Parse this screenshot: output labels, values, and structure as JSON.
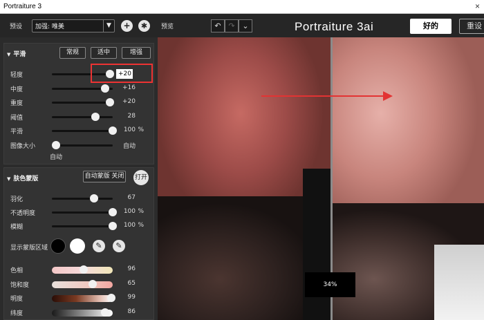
{
  "window": {
    "title": "Portraiture 3",
    "close_glyph": "×"
  },
  "topbar": {
    "preset_label": "预设",
    "preset_value": "加强: 唯美",
    "preview_label": "预览",
    "logo_text": "Portraiture 3ai",
    "ok_label": "好的",
    "reset_label": "重设"
  },
  "smooth": {
    "title": "平滑",
    "buttons": [
      "常规",
      "适中",
      "增强"
    ],
    "rows": [
      {
        "label": "轻度",
        "value": "+20",
        "level": 0.95
      },
      {
        "label": "中度",
        "value": "+16",
        "level": 0.87
      },
      {
        "label": "重度",
        "value": "+20",
        "level": 0.95
      },
      {
        "label": "阈值",
        "value": "28",
        "level": 0.69
      },
      {
        "label": "平滑",
        "value": "100",
        "unit": "%",
        "level": 1.0
      },
      {
        "label": "图像大小",
        "value": "自动",
        "level": 0.0
      }
    ],
    "size_note": "自动"
  },
  "skin": {
    "title": "肤色蒙版",
    "auto_mask_label": "自动蒙版 关闭",
    "open_label": "打开",
    "rows": [
      {
        "label": "羽化",
        "value": "67",
        "level": 0.67
      },
      {
        "label": "不透明度",
        "value": "100",
        "unit": "%",
        "level": 1.0
      },
      {
        "label": "模糊",
        "value": "100",
        "unit": "%",
        "level": 1.0
      }
    ],
    "show_mask_label": "显示蒙版区域",
    "color_rows": [
      {
        "label": "色相",
        "value": "96",
        "level": 0.49
      },
      {
        "label": "饱和度",
        "value": "65",
        "level": 0.65
      },
      {
        "label": "明度",
        "value": "99",
        "level": 0.97
      },
      {
        "label": "纬度",
        "value": "86",
        "level": 0.86
      }
    ]
  },
  "preview": {
    "zoom": "34%"
  },
  "icons": {
    "add": "plus-icon",
    "settings": "gear-icon",
    "undo": "undo-icon",
    "redo": "redo-icon",
    "history": "chevron-down-icon",
    "eyedropper": "eyedropper-icon"
  },
  "colors": {
    "annotation": "#e33333",
    "mask_black": "#000000",
    "mask_white": "#ffffff"
  }
}
